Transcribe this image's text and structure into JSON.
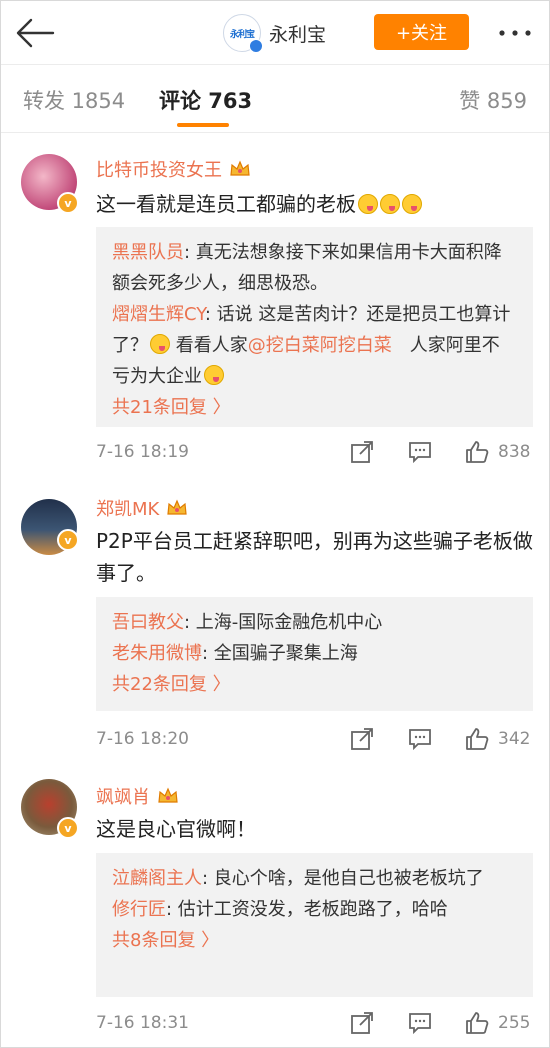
{
  "header": {
    "account_logo_text": "永利宝",
    "account_name": "永利宝",
    "follow_label": "+关注"
  },
  "tabs": {
    "repost": "转发 1854",
    "comment": "评论 763",
    "like": "赞 859"
  },
  "comments": [
    {
      "user": "比特币投资女王",
      "text": "这一看就是连员工都骗的老板",
      "replies": [
        {
          "name": "黑黑队员",
          "text": ": 真无法想象接下来如果信用卡大面积降额会死多少人，细思极恐。"
        },
        {
          "name": "熠熠生辉CY",
          "text_a": ": 话说 这是苦肉计？还是把员工也算计了？",
          "text_b": " 看看人家",
          "mention": "@挖白菜阿挖白菜",
          "text_c": "　人家阿里不亏为大企业"
        }
      ],
      "more_replies": "共21条回复 〉",
      "time": "7-16 18:19",
      "likes": "838"
    },
    {
      "user": "郑凯MK",
      "text": "P2P平台员工赶紧辞职吧，别再为这些骗子老板做事了。",
      "replies": [
        {
          "name": "吾曰教父",
          "text": ": 上海-国际金融危机中心"
        },
        {
          "name": "老朱用微博",
          "text": ": 全国骗子聚集上海"
        }
      ],
      "more_replies": "共22条回复 〉",
      "time": "7-16 18:20",
      "likes": "342"
    },
    {
      "user": "飒飒肖",
      "text": "这是良心官微啊！",
      "replies": [
        {
          "name": "泣麟阁主人",
          "text": ": 良心个啥，是他自己也被老板坑了"
        },
        {
          "name": "修行匠",
          "text": ": 估计工资没发，老板跑路了，哈哈"
        }
      ],
      "more_replies": "共8条回复 〉",
      "time": "7-16 18:31",
      "likes": "255"
    }
  ],
  "colors": {
    "accent": "#ff8200",
    "username": "#eb7350",
    "reply_bg": "#f2f2f2"
  }
}
